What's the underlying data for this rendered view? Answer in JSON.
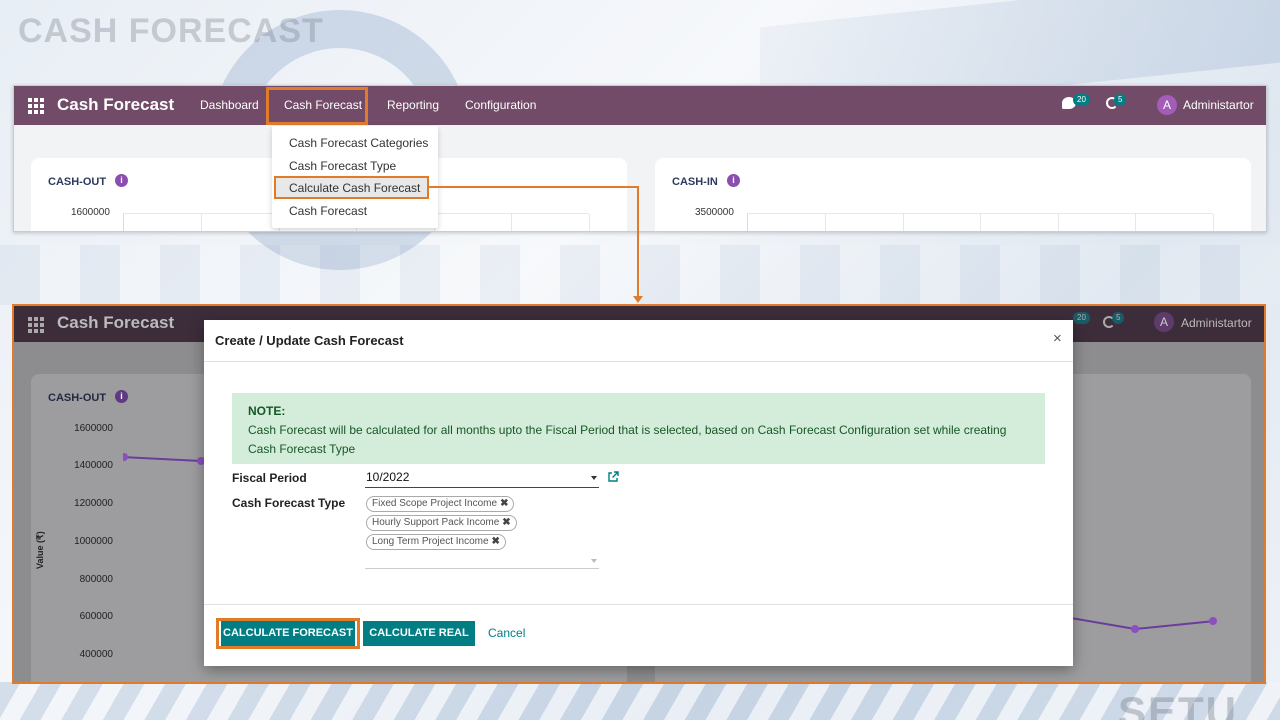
{
  "slide": {
    "title": "CASH FORECAST",
    "watermark": "SETU"
  },
  "navbar": {
    "brand": "Cash Forecast",
    "links": [
      "Dashboard",
      "Cash Forecast",
      "Reporting",
      "Configuration"
    ],
    "messages_count": "20",
    "activities_count": "5",
    "avatar_initial": "A",
    "user": "Administartor",
    "accent_color": "#714b67"
  },
  "menu": {
    "items": [
      "Cash Forecast Categories",
      "Cash Forecast Type",
      "Calculate Cash Forecast",
      "Cash Forecast"
    ],
    "active_item": "Calculate Cash Forecast"
  },
  "dashboard": {
    "cash_out": {
      "title": "CASH-OUT",
      "y_top": "1600000"
    },
    "cash_in": {
      "title": "CASH-IN",
      "y_top": "3500000"
    }
  },
  "background_chart": {
    "y_ticks": [
      "1600000",
      "1400000",
      "1200000",
      "1000000",
      "800000",
      "600000",
      "400000"
    ],
    "y_label": "Value (₹)"
  },
  "modal": {
    "title": "Create / Update Cash Forecast",
    "close_glyph": "×",
    "note_heading": "NOTE:",
    "note_text": "Cash Forecast will be calculated for all months upto the Fiscal Period that is selected, based on Cash Forecast Configuration set while creating Cash Forecast Type",
    "fiscal_period_label": "Fiscal Period",
    "fiscal_period_value": "10/2022",
    "forecast_type_label": "Cash Forecast Type",
    "forecast_types": [
      "Fixed Scope Project Income",
      "Hourly Support Pack Income",
      "Long Term Project Income"
    ],
    "tag_remove_glyph": "✖",
    "buttons": {
      "calculate_forecast": "CALCULATE FORECAST",
      "calculate_real": "CALCULATE REAL",
      "cancel": "Cancel"
    },
    "primary_color": "#017e84",
    "highlight_color": "#e07b2a"
  }
}
